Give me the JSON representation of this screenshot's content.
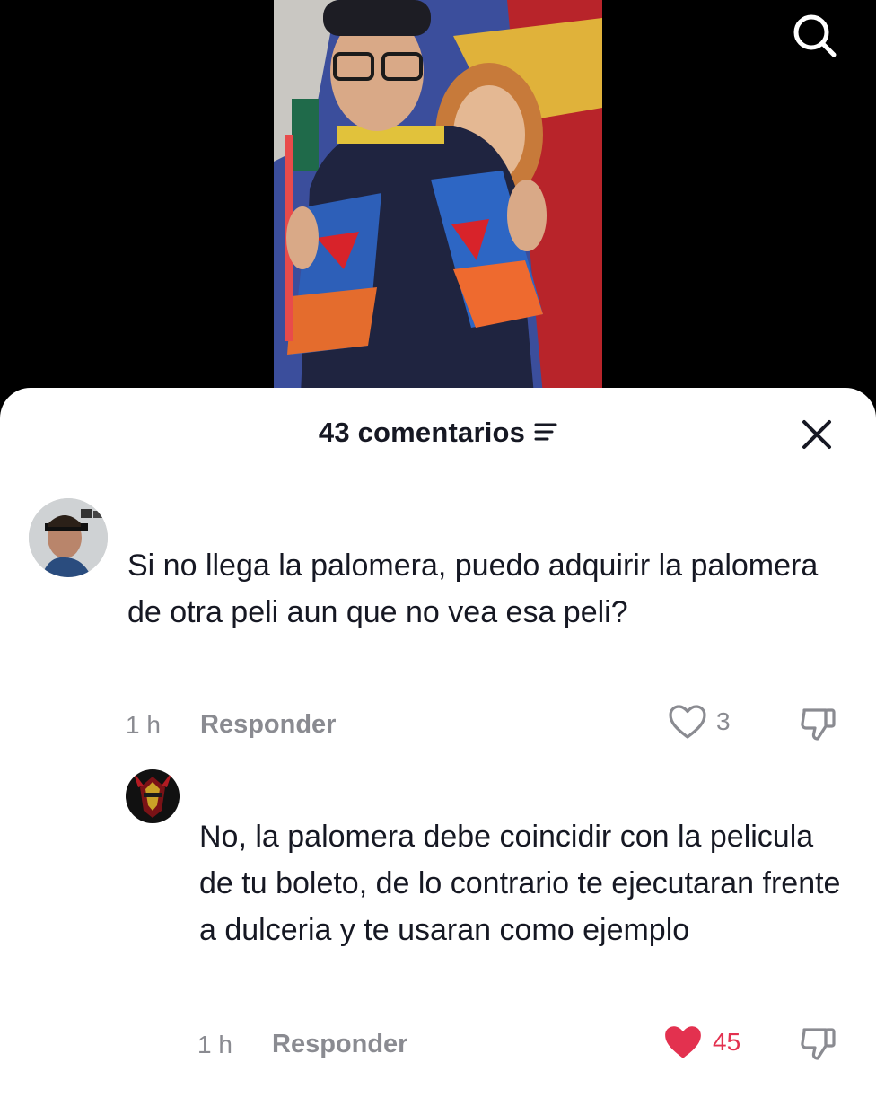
{
  "header": {
    "comments_count_label": "43 comentarios"
  },
  "comments": [
    {
      "username": "",
      "text": "Si no llega la palomera, puedo adquirir la palomera de otra peli aun que no vea esa peli?",
      "time": "1 h",
      "reply_label": "Responder",
      "likes": "3",
      "liked": false
    },
    {
      "text": "No, la palomera debe coincidir con la pelicula de tu boleto, de lo contrario te ejecutaran frente a dulceria y te usaran como ejemplo",
      "time": "1 h",
      "reply_label": "Responder",
      "likes": "45",
      "liked": true
    }
  ],
  "colors": {
    "like_active": "#e3314f",
    "text_primary": "#161823",
    "text_secondary": "#8a8b91"
  },
  "icons": {
    "search": "search-icon",
    "filter": "filter-icon",
    "close": "close-icon",
    "heart_outline": "heart-outline-icon",
    "heart_filled": "heart-filled-icon",
    "dislike": "dislike-icon"
  }
}
